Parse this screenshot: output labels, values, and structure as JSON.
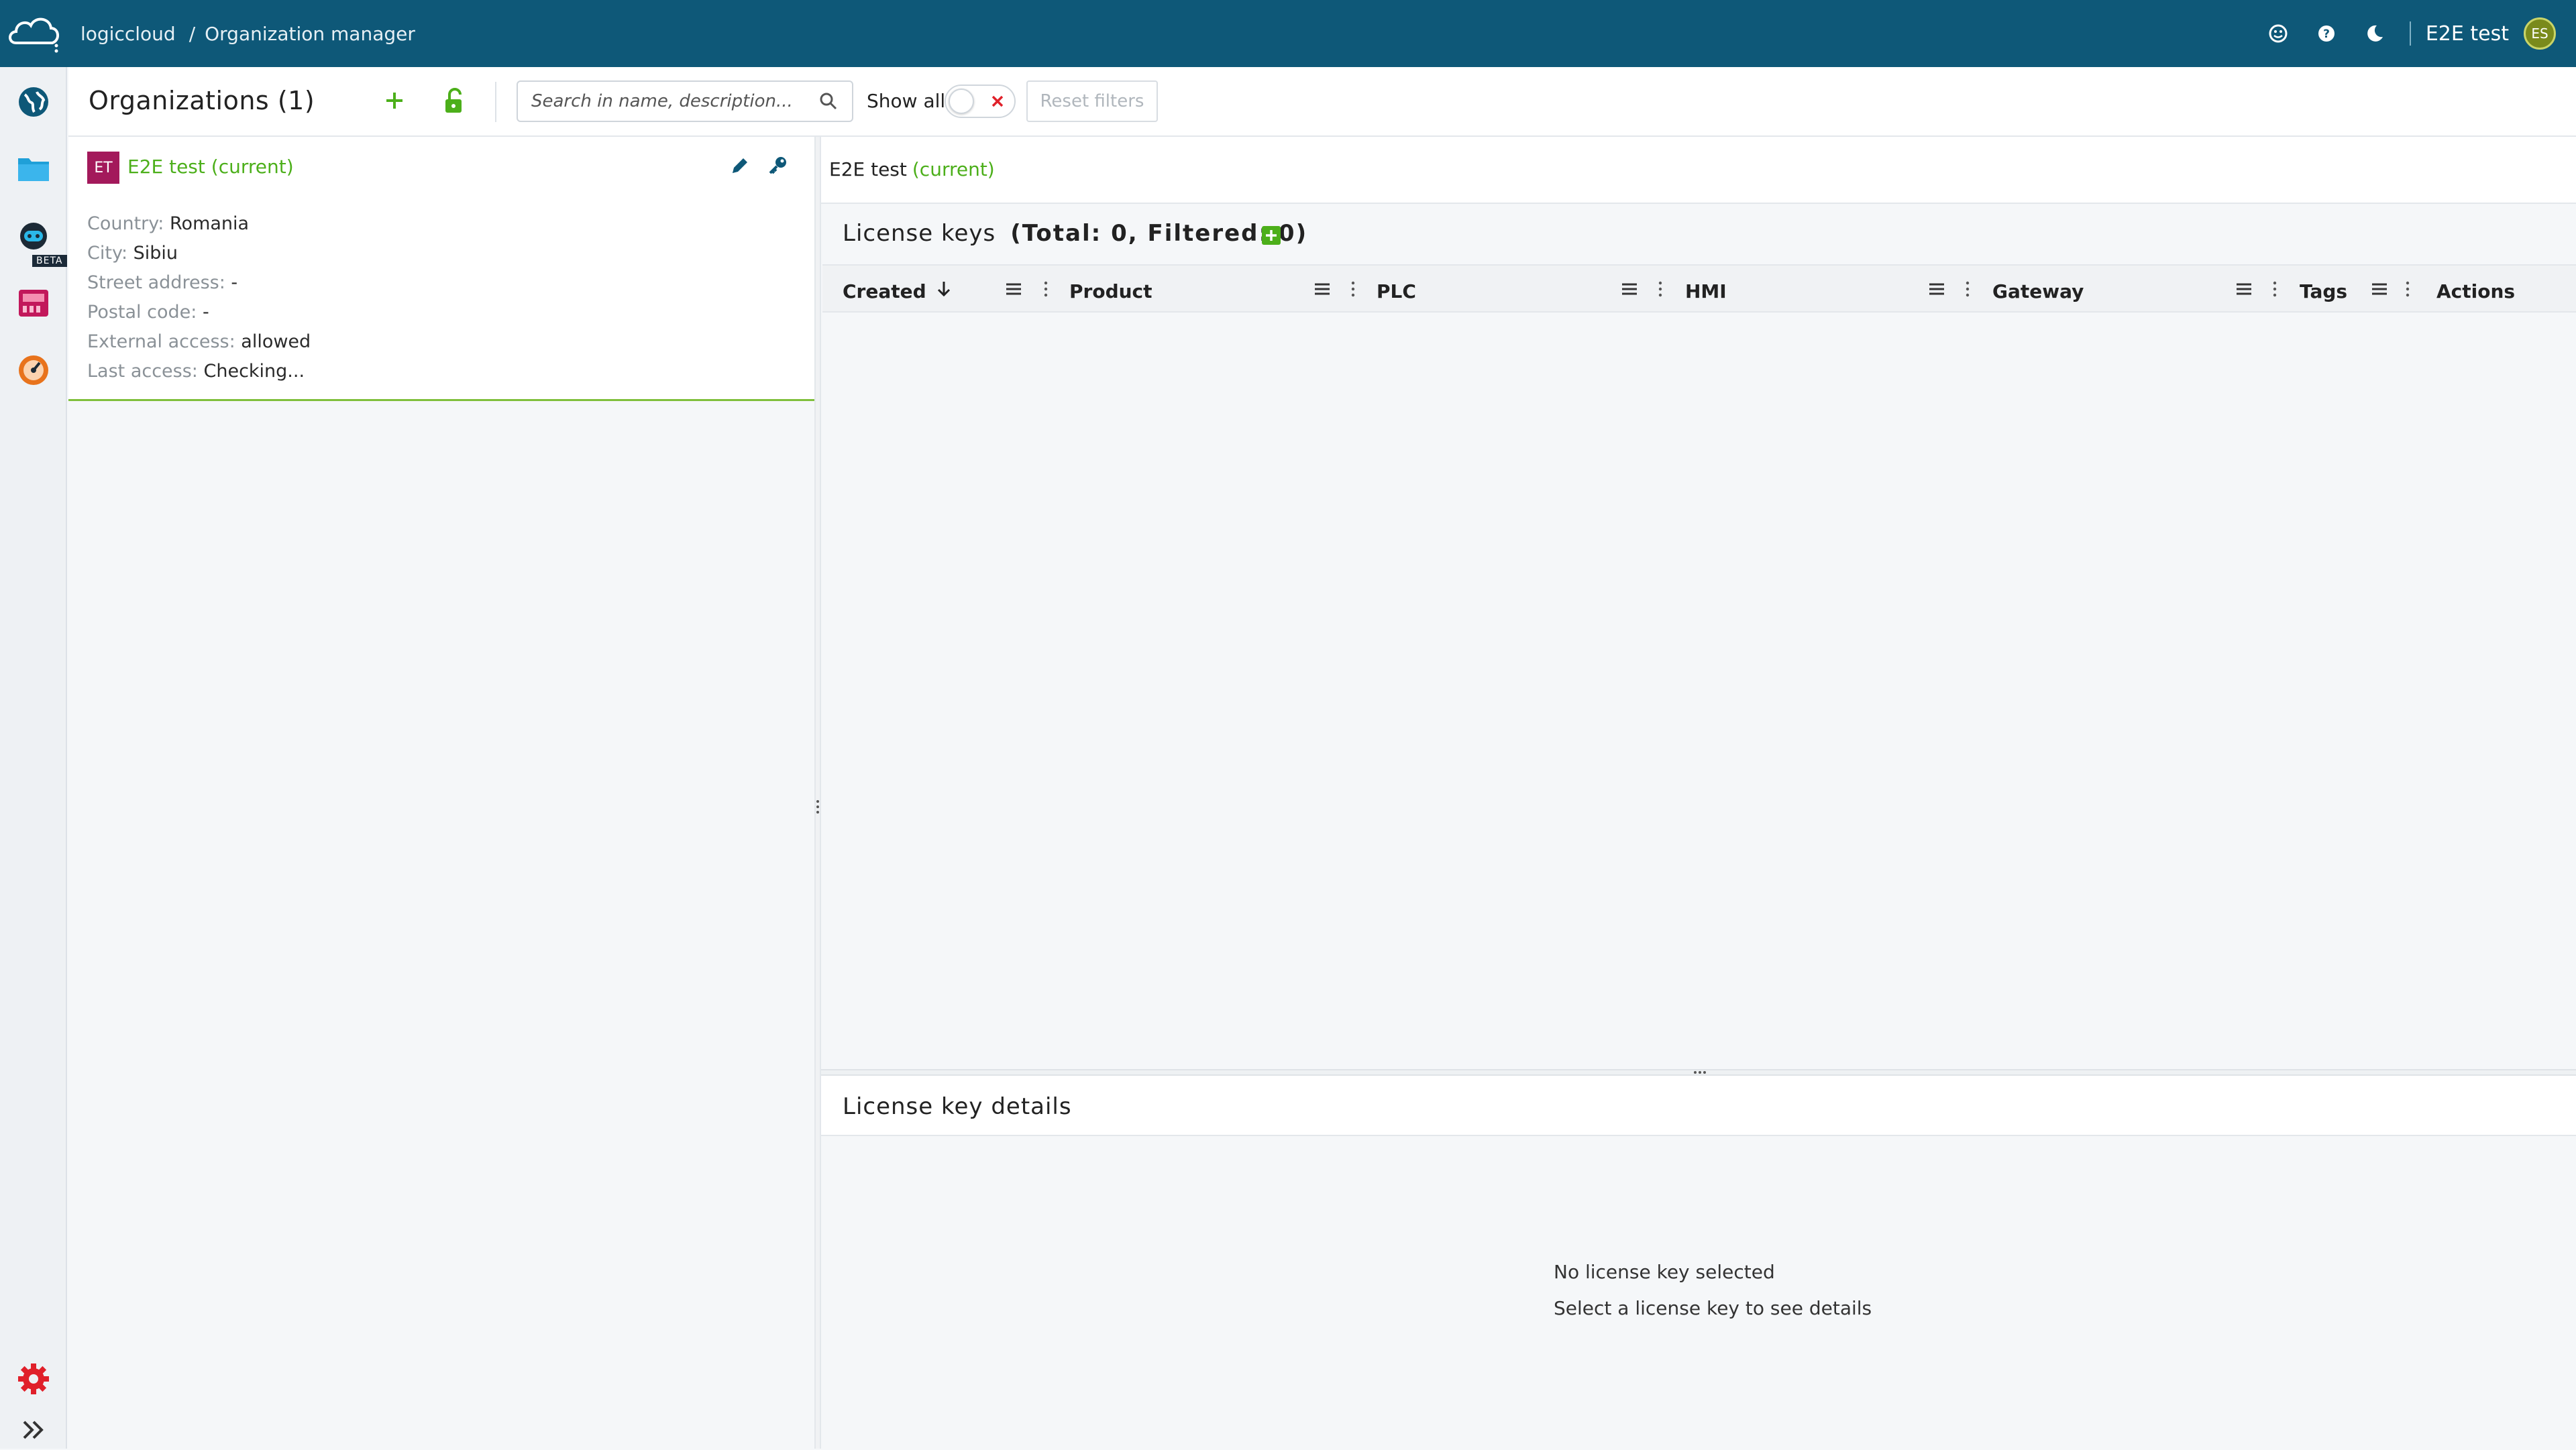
{
  "header": {
    "breadcrumb": [
      "logiccloud",
      "/",
      "Organization manager"
    ],
    "user_name": "E2E test",
    "avatar_initials": "ES",
    "icons": [
      "feedback-icon",
      "help-icon",
      "dark-mode-icon"
    ]
  },
  "sidebar": {
    "items": [
      "globe-icon",
      "folder-icon",
      "robot-icon",
      "device-icon",
      "gauge-icon"
    ],
    "beta_label": "BETA",
    "bottom": [
      "settings-icon",
      "expand-icon"
    ]
  },
  "toolbar": {
    "title": "Organizations (1)",
    "search_placeholder": "Search in name, description...",
    "show_all_label": "Show all",
    "reset_label": "Reset filters"
  },
  "organization": {
    "initials": "ET",
    "name": "E2E test (current)",
    "props": [
      {
        "key": "Country:",
        "value": "Romania"
      },
      {
        "key": "City:",
        "value": "Sibiu"
      },
      {
        "key": "Street address:",
        "value": "-"
      },
      {
        "key": "Postal code:",
        "value": "-"
      },
      {
        "key": "External access:",
        "value": "allowed"
      },
      {
        "key": "Last access:",
        "value": "Checking..."
      }
    ]
  },
  "selected": {
    "name": "E2E test",
    "current_label": "(current)"
  },
  "license_keys": {
    "title": "License keys",
    "counts": "(Total: 0, Filtered: 0)",
    "columns": [
      "Created",
      "Product",
      "PLC",
      "HMI",
      "Gateway",
      "Tags",
      "Actions"
    ]
  },
  "details": {
    "title": "License key details",
    "empty_title": "No license key selected",
    "empty_hint": "Select a license key to see details"
  },
  "colors": {
    "header_bg": "#0e5878",
    "accent_green": "#4caf1a",
    "org_badge": "#a3195b"
  }
}
